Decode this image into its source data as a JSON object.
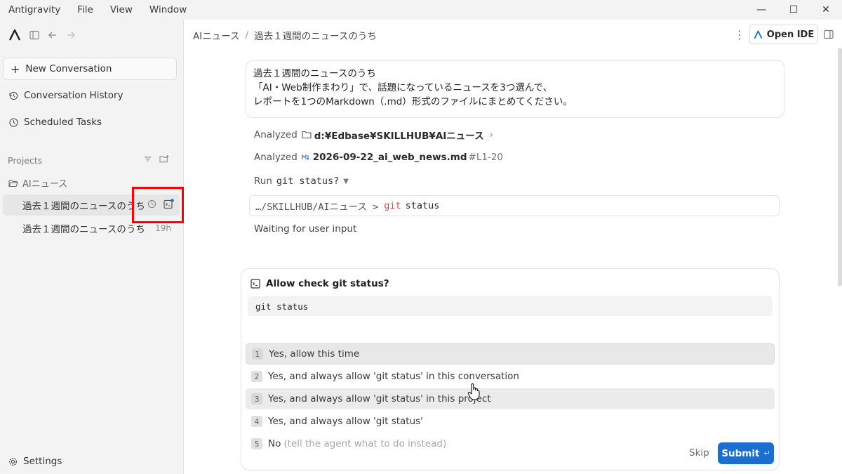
{
  "menu": {
    "app": "Antigravity",
    "items": [
      "File",
      "View",
      "Window"
    ]
  },
  "window_controls": {
    "minimize": "—",
    "maximize": "☐",
    "close": "✕"
  },
  "sidebar": {
    "new_conversation": "New Conversation",
    "history": "Conversation History",
    "scheduled": "Scheduled Tasks",
    "projects_label": "Projects",
    "project_name": "AIニュース",
    "conversations": [
      {
        "title": "過去１週間のニュースのうち",
        "time": ""
      },
      {
        "title": "過去１週間のニュースのうち",
        "time": "19h"
      }
    ],
    "settings": "Settings"
  },
  "header": {
    "crumb_project": "AIニュース",
    "crumb_sep": "/",
    "crumb_title": "過去１週間のニュースのうち",
    "open_ide": "Open IDE"
  },
  "prompt": {
    "line1": "過去１週間のニュースのうち",
    "line2": "「AI・Web制作まわり」で、話題になっているニュースを3つ選んで、",
    "line3": "レポートを1つのMarkdown（.md）形式のファイルにまとめてください。"
  },
  "steps": {
    "analyzed1_label": "Analyzed",
    "analyzed1_path": "d:¥Edbase¥SKILLHUB¥AIニュース",
    "analyzed2_label": "Analyzed",
    "analyzed2_file": "2026-09-22_ai_web_news.md",
    "analyzed2_ref": "#L1-20",
    "run_label": "Run",
    "run_cmd": "git status?",
    "cmd_path": "…/SKILLHUB/AIニュース >",
    "cmd_git": "git",
    "cmd_arg": "status",
    "waiting": "Waiting for user input"
  },
  "dialog": {
    "title": "Allow check git status?",
    "command": "git status",
    "options": [
      {
        "num": "1",
        "label": "Yes, allow this time",
        "hint": ""
      },
      {
        "num": "2",
        "label": "Yes, and always allow 'git status' in this conversation",
        "hint": ""
      },
      {
        "num": "3",
        "label": "Yes, and always allow 'git status' in this project",
        "hint": ""
      },
      {
        "num": "4",
        "label": "Yes, and always allow 'git status'",
        "hint": ""
      },
      {
        "num": "5",
        "label": "No",
        "hint": "(tell the agent what to do instead)"
      }
    ],
    "skip": "Skip",
    "submit": "Submit",
    "submit_key": "↵"
  },
  "colors": {
    "accent": "#1a6fd1",
    "highlight_box": "#ff0000",
    "git_keyword": "#d14a4a"
  }
}
